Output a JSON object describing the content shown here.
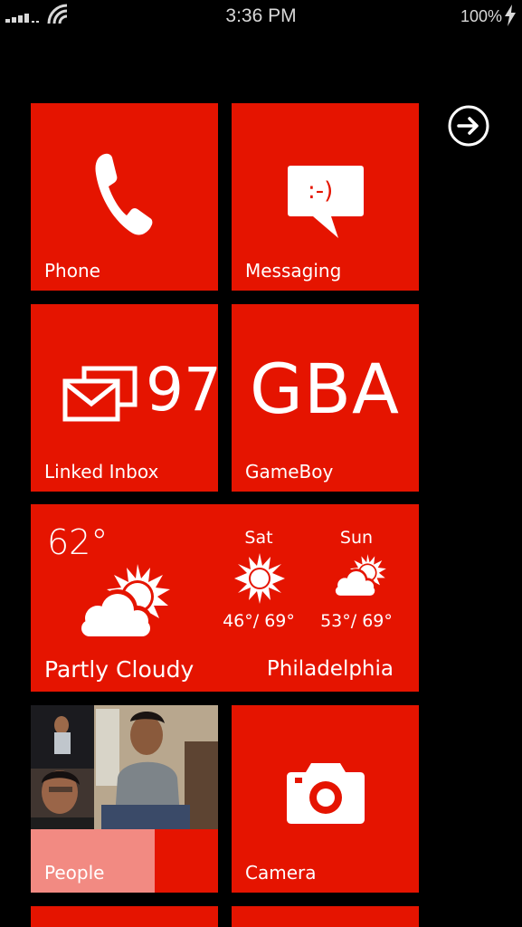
{
  "status": {
    "time": "3:36 PM",
    "battery": "100%"
  },
  "tiles": {
    "phone": {
      "label": "Phone"
    },
    "messaging": {
      "label": "Messaging",
      "emoticon": ":-)"
    },
    "linked_inbox": {
      "label": "Linked Inbox",
      "count": "97"
    },
    "gameboy": {
      "label": "GameBoy",
      "text": "GBA"
    },
    "weather": {
      "temp": "62°",
      "condition": "Partly Cloudy",
      "city": "Philadelphia",
      "forecast": [
        {
          "day": "Sat",
          "range": "46°/ 69°"
        },
        {
          "day": "Sun",
          "range": "53°/ 69°"
        }
      ]
    },
    "people": {
      "label": "People"
    },
    "camera": {
      "label": "Camera"
    }
  },
  "colors": {
    "tile": "#e51400",
    "background": "#000000",
    "people_overlay": "#f28a82"
  },
  "icons": [
    "signal-icon",
    "wifi-icon",
    "charging-icon",
    "arrow-right-icon",
    "phone-icon",
    "message-bubble-icon",
    "mail-icon",
    "sun-cloud-icon",
    "sun-icon",
    "camera-icon"
  ]
}
